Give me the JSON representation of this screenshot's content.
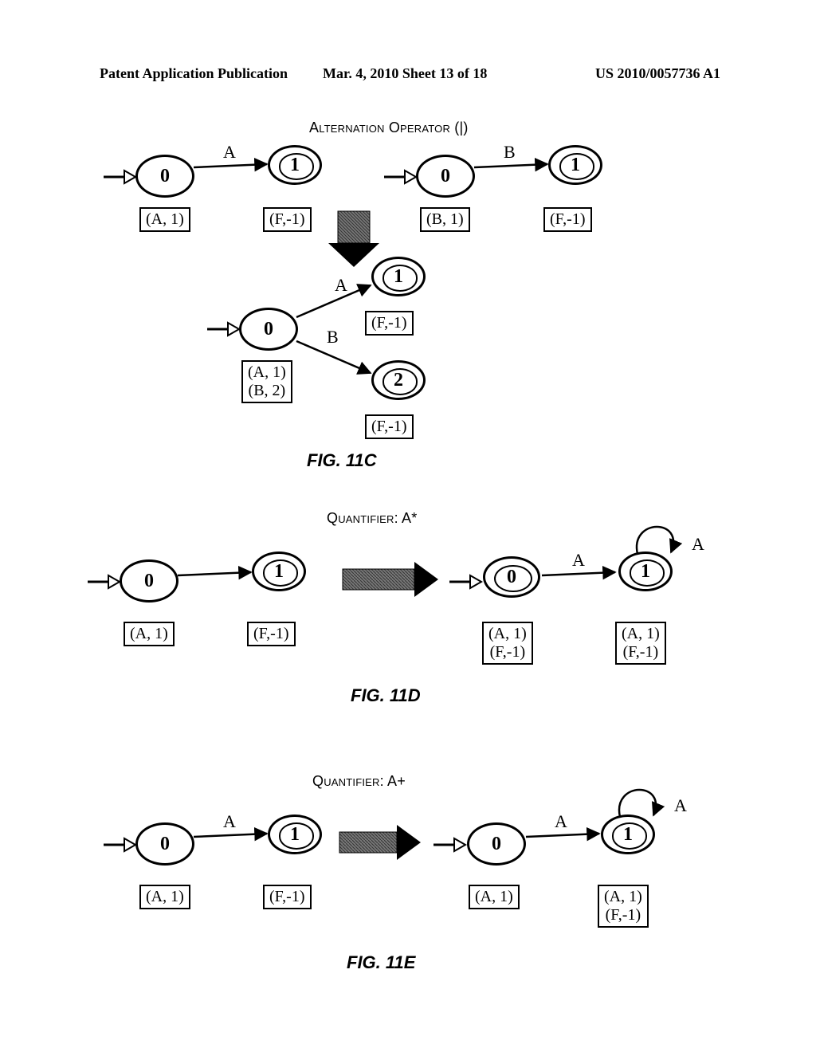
{
  "header": {
    "left": "Patent Application Publication",
    "mid": "Mar. 4, 2010  Sheet 13 of 18",
    "right": "US 2010/0057736 A1"
  },
  "fig11c": {
    "title": "Alternation Operator (|)",
    "caption": "FIG. 11C",
    "topLeft": {
      "n0": "0",
      "n1": "1",
      "edge": "A",
      "box0": "(A, 1)",
      "box1": "(F,-1)"
    },
    "topRight": {
      "n0": "0",
      "n1": "1",
      "edge": "B",
      "box0": "(B, 1)",
      "box1": "(F,-1)"
    },
    "bottom": {
      "n0": "0",
      "n1": "1",
      "n2": "2",
      "edgeA": "A",
      "edgeB": "B",
      "box0a": "(A, 1)",
      "box0b": "(B, 2)",
      "box1": "(F,-1)",
      "box2": "(F,-1)"
    }
  },
  "fig11d": {
    "title": "Quantifier: A*",
    "caption": "FIG. 11D",
    "left": {
      "n0": "0",
      "n1": "1",
      "box0": "(A, 1)",
      "box1": "(F,-1)"
    },
    "right": {
      "n0": "0",
      "n1": "1",
      "edge01": "A",
      "edgeLoop": "A",
      "box0a": "(A, 1)",
      "box0b": "(F,-1)",
      "box1a": "(A, 1)",
      "box1b": "(F,-1)"
    }
  },
  "fig11e": {
    "title": "Quantifier: A+",
    "caption": "FIG. 11E",
    "left": {
      "n0": "0",
      "n1": "1",
      "edge": "A",
      "box0": "(A, 1)",
      "box1": "(F,-1)"
    },
    "right": {
      "n0": "0",
      "n1": "1",
      "edge01": "A",
      "edgeLoop": "A",
      "box0": "(A, 1)",
      "box1a": "(A, 1)",
      "box1b": "(F,-1)"
    }
  }
}
